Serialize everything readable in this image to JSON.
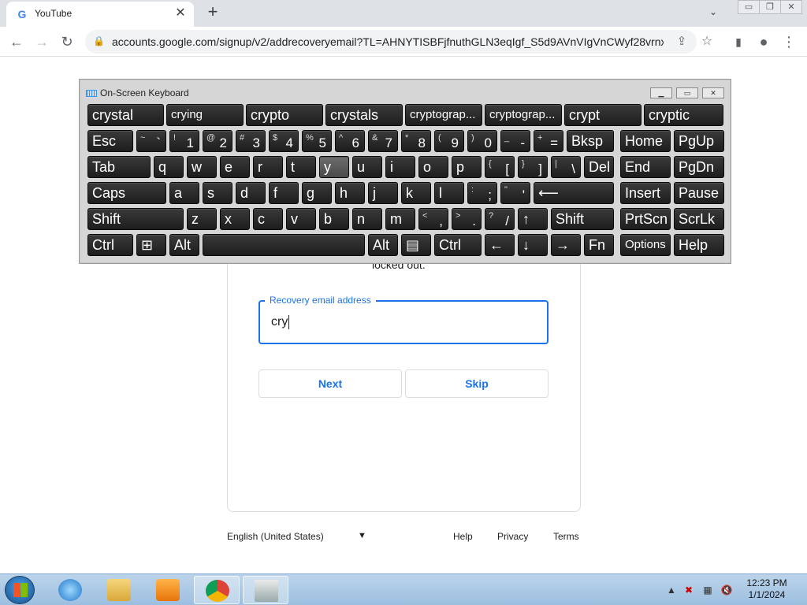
{
  "browser": {
    "tab_title": "YouTube",
    "tab_close": "✕",
    "new_tab": "+",
    "tab_search": "⌄",
    "url": "accounts.google.com/signup/v2/addrecoveryemail?TL=AHNYTISBFjfnuthGLN3eqIgf_S5d9AVnVIgVnCWyf28vrnx...",
    "window_controls": [
      "▭",
      "❐",
      "✕"
    ]
  },
  "page": {
    "partial_text": "locked out.",
    "field_label": "Recovery email address",
    "field_value": "cry",
    "next_label": "Next",
    "skip_label": "Skip",
    "language": "English (United States)",
    "footer_links": [
      "Help",
      "Privacy",
      "Terms"
    ]
  },
  "osk": {
    "title": "On-Screen Keyboard",
    "suggestions": [
      "crystal",
      "crying",
      "crypto",
      "crystals",
      "cryptograp...",
      "cryptograp...",
      "crypt",
      "cryptic"
    ],
    "row1_labels": [
      "Esc",
      "Bksp",
      "Home",
      "PgUp"
    ],
    "row2_labels": [
      "Tab",
      "q",
      "w",
      "e",
      "r",
      "t",
      "y",
      "u",
      "i",
      "o",
      "p",
      "Del",
      "End",
      "PgDn"
    ],
    "row3_labels": [
      "Caps",
      "a",
      "s",
      "d",
      "f",
      "g",
      "h",
      "j",
      "k",
      "l",
      "Insert",
      "Pause"
    ],
    "row4_labels": [
      "Shift",
      "z",
      "x",
      "c",
      "v",
      "b",
      "n",
      "m",
      "Shift",
      "PrtScn",
      "ScrLk"
    ],
    "row5_labels": [
      "Ctrl",
      "Alt",
      "Alt",
      "Ctrl",
      "Fn",
      "Options",
      "Help"
    ],
    "numkeys": [
      {
        "sec": "~",
        "pri": "`"
      },
      {
        "sec": "!",
        "pri": "1"
      },
      {
        "sec": "@",
        "pri": "2"
      },
      {
        "sec": "#",
        "pri": "3"
      },
      {
        "sec": "$",
        "pri": "4"
      },
      {
        "sec": "%",
        "pri": "5"
      },
      {
        "sec": "^",
        "pri": "6"
      },
      {
        "sec": "&",
        "pri": "7"
      },
      {
        "sec": "*",
        "pri": "8"
      },
      {
        "sec": "(",
        "pri": "9"
      },
      {
        "sec": ")",
        "pri": "0"
      },
      {
        "sec": "_",
        "pri": "-"
      },
      {
        "sec": "+",
        "pri": "="
      }
    ],
    "bracket_keys": [
      {
        "sec": "{",
        "pri": "["
      },
      {
        "sec": "}",
        "pri": "]"
      },
      {
        "sec": "|",
        "pri": "\\"
      }
    ],
    "semi_keys": [
      {
        "sec": ":",
        "pri": ";"
      },
      {
        "sec": "\"",
        "pri": "'"
      }
    ],
    "enter_symbol": "⟵",
    "punct_keys": [
      {
        "sec": "<",
        "pri": ","
      },
      {
        "sec": ">",
        "pri": "."
      },
      {
        "sec": "?",
        "pri": "/"
      }
    ],
    "arrows": [
      "↑",
      "←",
      "↓",
      "→"
    ],
    "win_symbol": "⊞",
    "menu_symbol": "▤"
  },
  "taskbar": {
    "time": "12:23 PM",
    "date": "1/1/2024",
    "tray_icons": [
      "▲",
      "✖",
      "▦",
      "🔇"
    ]
  }
}
